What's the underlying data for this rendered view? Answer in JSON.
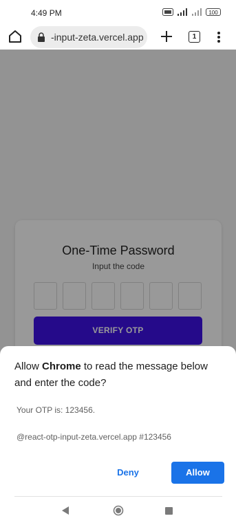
{
  "status_bar": {
    "time": "4:49 PM",
    "battery": "100",
    "icons": [
      "volte-icon",
      "signal-icon",
      "signal-icon",
      "battery-icon"
    ]
  },
  "browser": {
    "url": "-input-zeta.vercel.app",
    "tab_count": "1",
    "icons": [
      "home-icon",
      "lock-icon",
      "new-tab-icon",
      "tabs-icon",
      "menu-icon"
    ]
  },
  "page": {
    "title": "One-Time Password",
    "subtitle": "Input the code",
    "otp_boxes": 6,
    "verify_label": "VERIFY OTP",
    "accent_color": "#3f12e6"
  },
  "sheet": {
    "title_before": "Allow ",
    "title_app": "Chrome",
    "title_after": " to read the message below and enter the code?",
    "message": "Your OTP is: 123456.",
    "origin": "@react-otp-input-zeta.vercel.app #123456",
    "deny_label": "Deny",
    "allow_label": "Allow",
    "accent_color": "#1a73e8"
  },
  "nav": {
    "icons": [
      "back-icon",
      "home-icon",
      "recents-icon"
    ]
  }
}
